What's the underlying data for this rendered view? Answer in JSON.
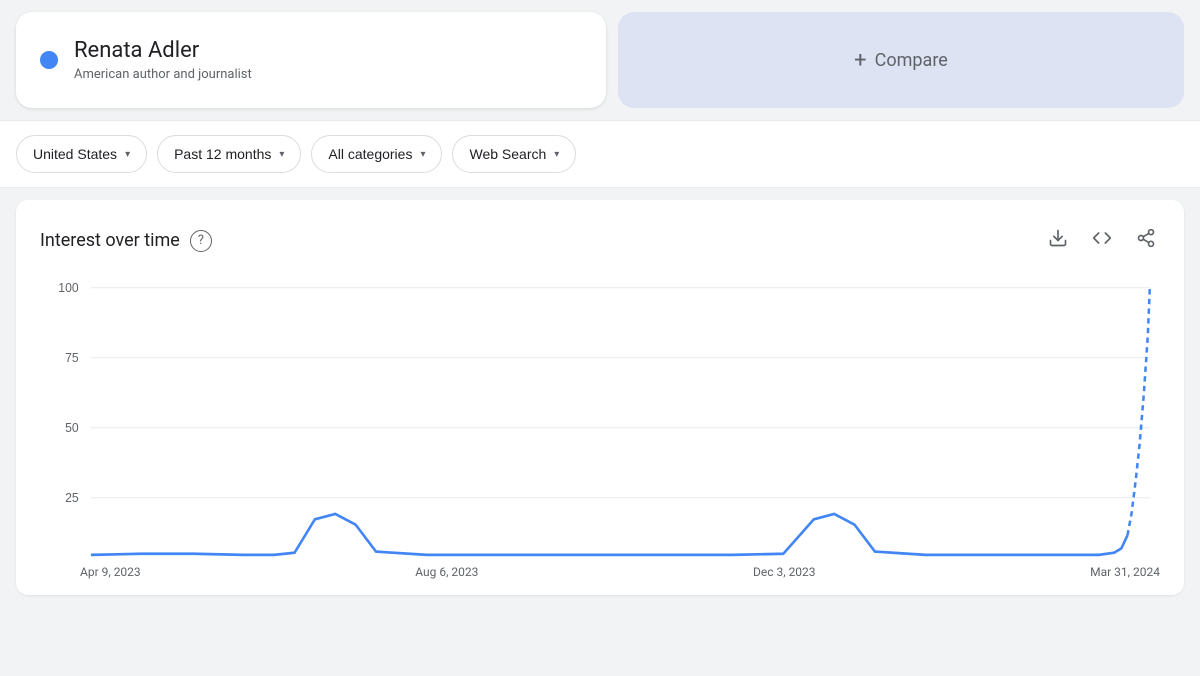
{
  "search_card": {
    "title": "Renata Adler",
    "subtitle": "American author and journalist"
  },
  "compare": {
    "label": "Compare"
  },
  "filters": {
    "region": "United States",
    "time": "Past 12 months",
    "category": "All categories",
    "search_type": "Web Search"
  },
  "chart": {
    "title": "Interest over time",
    "y_labels": [
      "100",
      "75",
      "50",
      "25"
    ],
    "x_labels": [
      "Apr 9, 2023",
      "Aug 6, 2023",
      "Dec 3, 2023",
      "Mar 31, 2024"
    ]
  },
  "icons": {
    "chevron": "▾",
    "question": "?",
    "download": "⬇",
    "code": "<>",
    "share": "⬆",
    "plus": "+"
  }
}
